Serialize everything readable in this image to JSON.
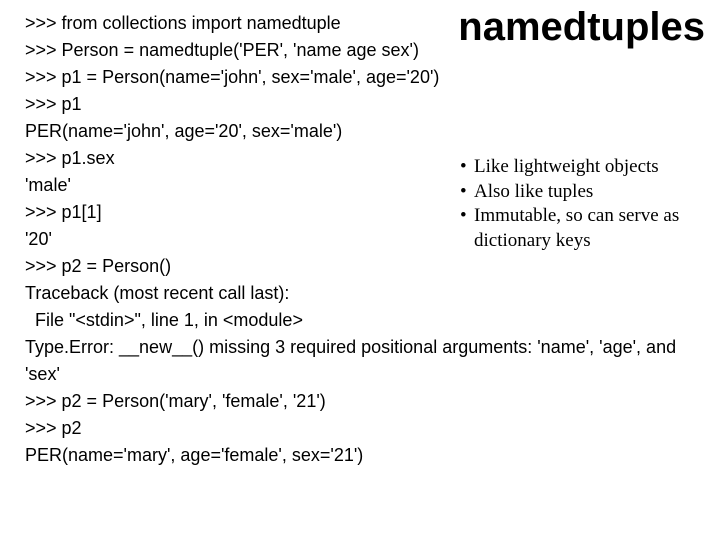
{
  "title": "namedtuples",
  "code": {
    "l1": ">>> from collections import namedtuple",
    "l2": ">>> Person = namedtuple('PER', 'name age sex')",
    "l3": ">>> p1 = Person(name='john', sex='male', age='20')",
    "l4": ">>> p1",
    "l5": "PER(name='john', age='20', sex='male')",
    "l6": ">>> p1.sex",
    "l7": "'male'",
    "l8": ">>> p1[1]",
    "l9": "'20'",
    "l10": ">>> p2 = Person()",
    "l11": "Traceback (most recent call last):",
    "l12": "  File \"<stdin>\", line 1, in <module>",
    "l13": "Type.Error: __new__() missing 3 required positional arguments: 'name', 'age', and 'sex'",
    "l14": ">>> p2 = Person('mary', 'female', '21')",
    "l15": ">>> p2",
    "l16": "PER(name='mary', age='female', sex='21')"
  },
  "bullets": {
    "b1": "Like lightweight objects",
    "b2": "Also like tuples",
    "b3": "Immutable, so can serve as dictionary keys"
  }
}
